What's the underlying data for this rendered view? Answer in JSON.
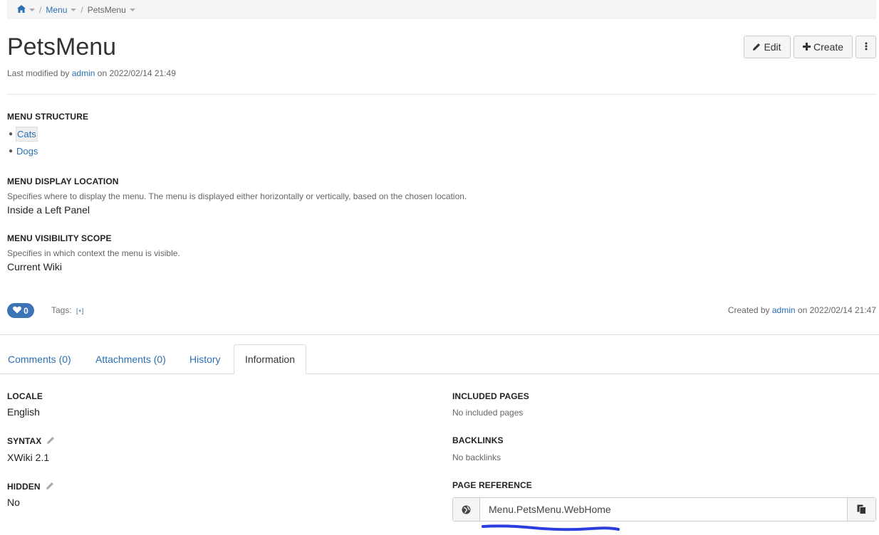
{
  "breadcrumb": {
    "item1": "Menu",
    "item2": "PetsMenu"
  },
  "page": {
    "title": "PetsMenu",
    "modified_prefix": "Last modified by",
    "modified_user": "admin",
    "modified_on": "on 2022/02/14 21:49"
  },
  "toolbar": {
    "edit": "Edit",
    "create": "Create"
  },
  "menu_structure": {
    "heading": "MENU STRUCTURE",
    "items": [
      "Cats",
      "Dogs"
    ]
  },
  "display_location": {
    "heading": "MENU DISPLAY LOCATION",
    "hint": "Specifies where to display the menu. The menu is displayed either horizontally or vertically, based on the chosen location.",
    "value": "Inside a Left Panel"
  },
  "visibility_scope": {
    "heading": "MENU VISIBILITY SCOPE",
    "hint": "Specifies in which context the menu is visible.",
    "value": "Current Wiki"
  },
  "footer": {
    "likes": "0",
    "tags_label": "Tags:",
    "tags_add": "[+]",
    "created_prefix": "Created by",
    "created_user": "admin",
    "created_on": "on 2022/02/14 21:47"
  },
  "tabs": {
    "comments": "Comments (0)",
    "attachments": "Attachments (0)",
    "history": "History",
    "information": "Information"
  },
  "info": {
    "locale_h": "LOCALE",
    "locale_v": "English",
    "syntax_h": "SYNTAX",
    "syntax_v": "XWiki 2.1",
    "hidden_h": "HIDDEN",
    "hidden_v": "No",
    "included_h": "INCLUDED PAGES",
    "included_v": "No included pages",
    "backlinks_h": "BACKLINKS",
    "backlinks_v": "No backlinks",
    "reference_h": "PAGE REFERENCE",
    "reference_v": "Menu.PetsMenu.WebHome"
  },
  "icons": {
    "home": "home-icon",
    "pencil": "pencil-icon",
    "plus": "plus-icon",
    "more": "more-vertical-icon",
    "heart": "heart-icon",
    "globe": "globe-icon",
    "copy": "copy-icon"
  },
  "colors": {
    "link": "#2a6fb2",
    "like_badge": "#3d74b5",
    "annotation": "#2c3de0"
  }
}
